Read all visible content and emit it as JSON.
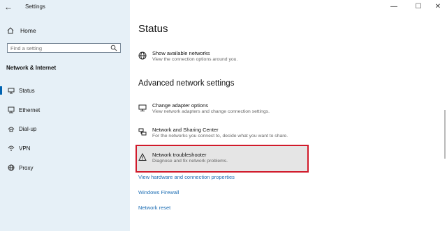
{
  "window": {
    "title": "Settings",
    "minimize_glyph": "—",
    "maximize_glyph": "☐",
    "close_glyph": "✕",
    "back_glyph": "←"
  },
  "sidebar": {
    "home_label": "Home",
    "search_placeholder": "Find a setting",
    "group_title": "Network & Internet",
    "items": [
      {
        "label": "Status",
        "icon": "status-icon",
        "active": true
      },
      {
        "label": "Ethernet",
        "icon": "ethernet-icon"
      },
      {
        "label": "Dial-up",
        "icon": "dial-up-icon"
      },
      {
        "label": "VPN",
        "icon": "vpn-icon"
      },
      {
        "label": "Proxy",
        "icon": "globe-icon"
      }
    ]
  },
  "main": {
    "page_title": "Status",
    "show_networks": {
      "title": "Show available networks",
      "desc": "View the connection options around you."
    },
    "section_title": "Advanced network settings",
    "rows": [
      {
        "title": "Change adapter options",
        "desc": "View network adapters and change connection settings.",
        "icon": "adapter-icon"
      },
      {
        "title": "Network and Sharing Center",
        "desc": "For the networks you connect to, decide what you want to share.",
        "icon": "sharing-center-icon"
      },
      {
        "title": "Network troubleshooter",
        "desc": "Diagnose and fix network problems.",
        "icon": "warning-icon"
      }
    ],
    "links": [
      "View hardware and connection properties",
      "Windows Firewall",
      "Network reset"
    ]
  },
  "colors": {
    "sidebar_bg": "#e6f0f7",
    "accent": "#0063b1",
    "link": "#1a6cb3",
    "highlight_border": "#d11a2a",
    "highlight_bg": "#e5e5e5"
  }
}
